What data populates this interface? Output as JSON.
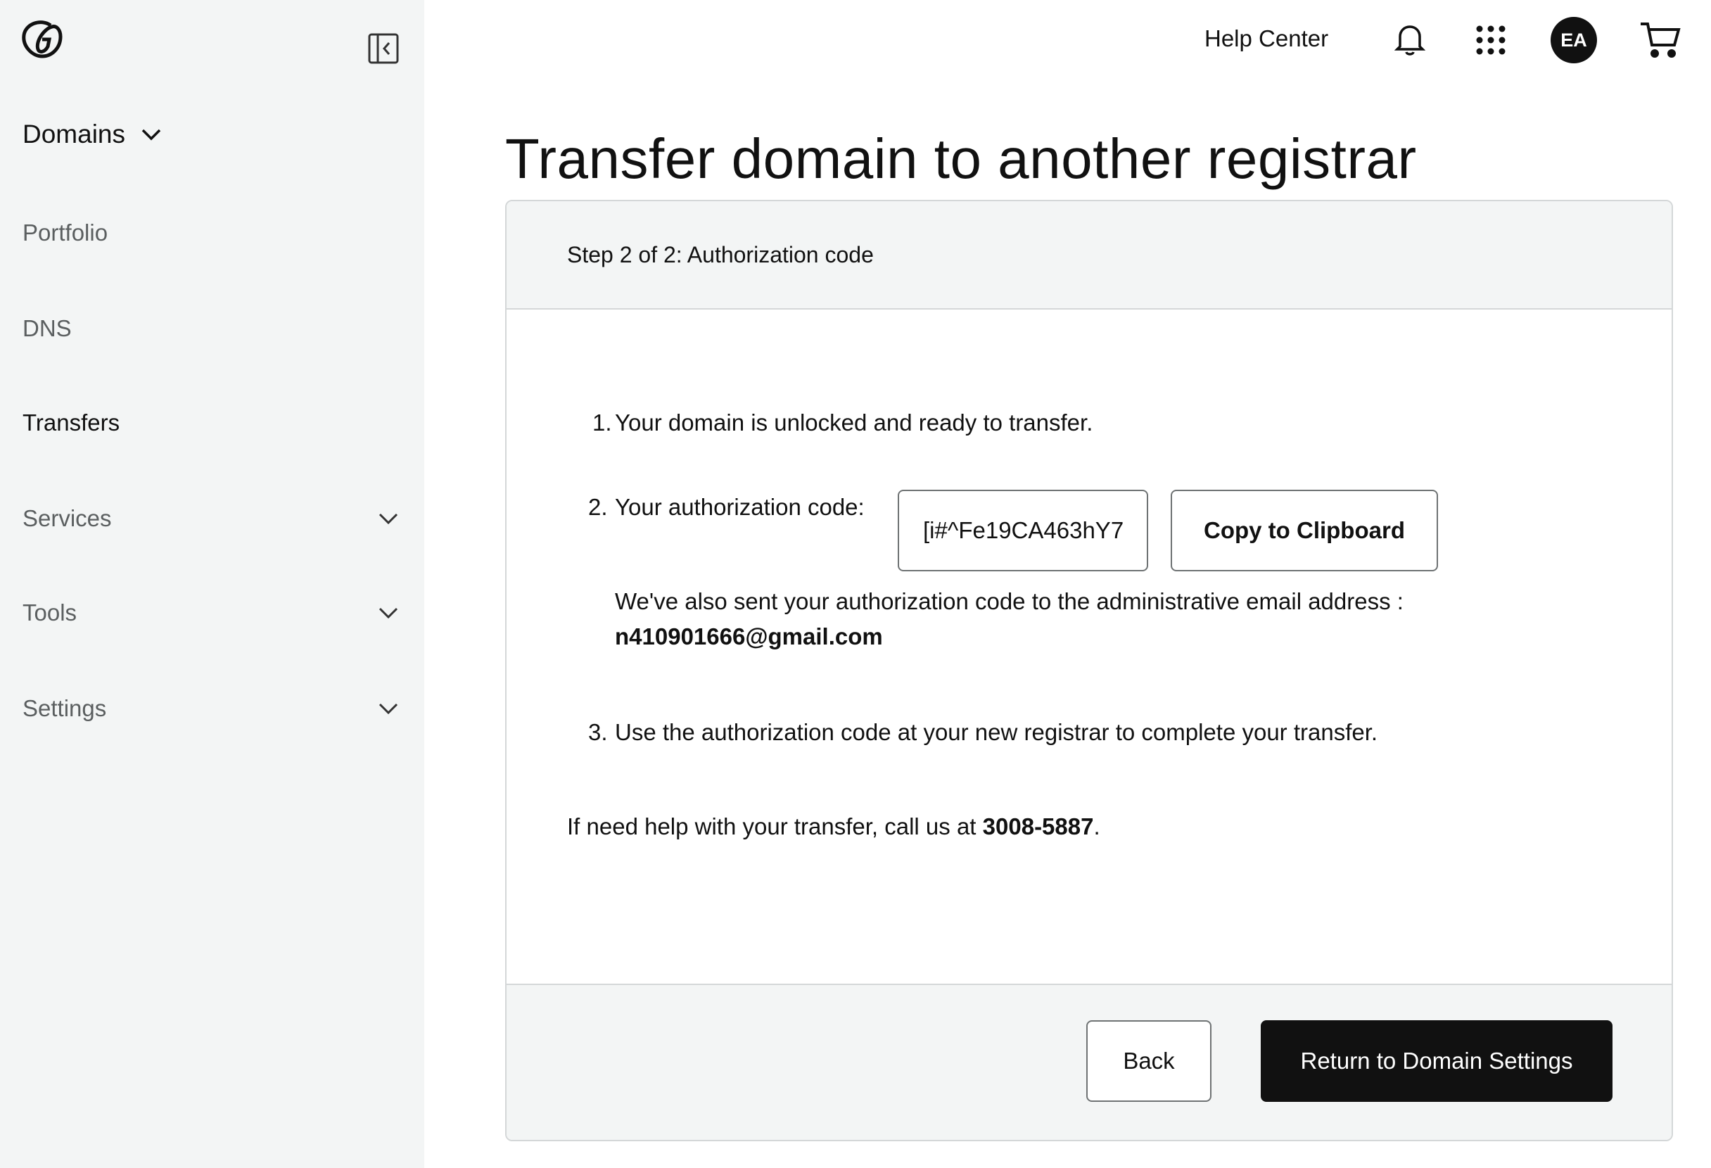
{
  "sidebar": {
    "logo_icon": "godaddy-logo-icon",
    "collapse_icon": "sidebar-collapse-icon",
    "heading": "Domains",
    "items": [
      {
        "label": "Portfolio",
        "has_chevron": false
      },
      {
        "label": "DNS",
        "has_chevron": false
      },
      {
        "label": "Transfers",
        "has_chevron": false,
        "active": true
      },
      {
        "label": "Services",
        "has_chevron": true
      },
      {
        "label": "Tools",
        "has_chevron": true
      },
      {
        "label": "Settings",
        "has_chevron": true
      }
    ]
  },
  "topbar": {
    "help_center": "Help Center",
    "avatar_initials": "EA",
    "icons": [
      "bell-icon",
      "apps-grid-icon",
      "cart-icon"
    ]
  },
  "main": {
    "title": "Transfer domain to another registrar",
    "step_label": "Step 2 of 2: Authorization code",
    "steps": [
      {
        "num": "1.",
        "text": "Your domain is unlocked and ready to transfer."
      },
      {
        "num": "2.",
        "text": "Your authorization code:"
      },
      {
        "num": "3.",
        "text": "Use the authorization code at your new registrar to complete your transfer."
      }
    ],
    "auth_code": "[i#^Fe19CA463hY7",
    "copy_button": "Copy to Clipboard",
    "email_note_prefix": "We've also sent your authorization code to the administrative email address :",
    "email": "n410901666@gmail.com",
    "help_prefix": "If need help with your transfer, call us at",
    "phone": "3008-5887",
    "help_suffix": ".",
    "back_button": "Back",
    "return_button": "Return to Domain Settings"
  },
  "colors": {
    "sidebar_bg": "#f3f5f5",
    "primary_button": "#111111",
    "border": "#d4d7d8"
  }
}
